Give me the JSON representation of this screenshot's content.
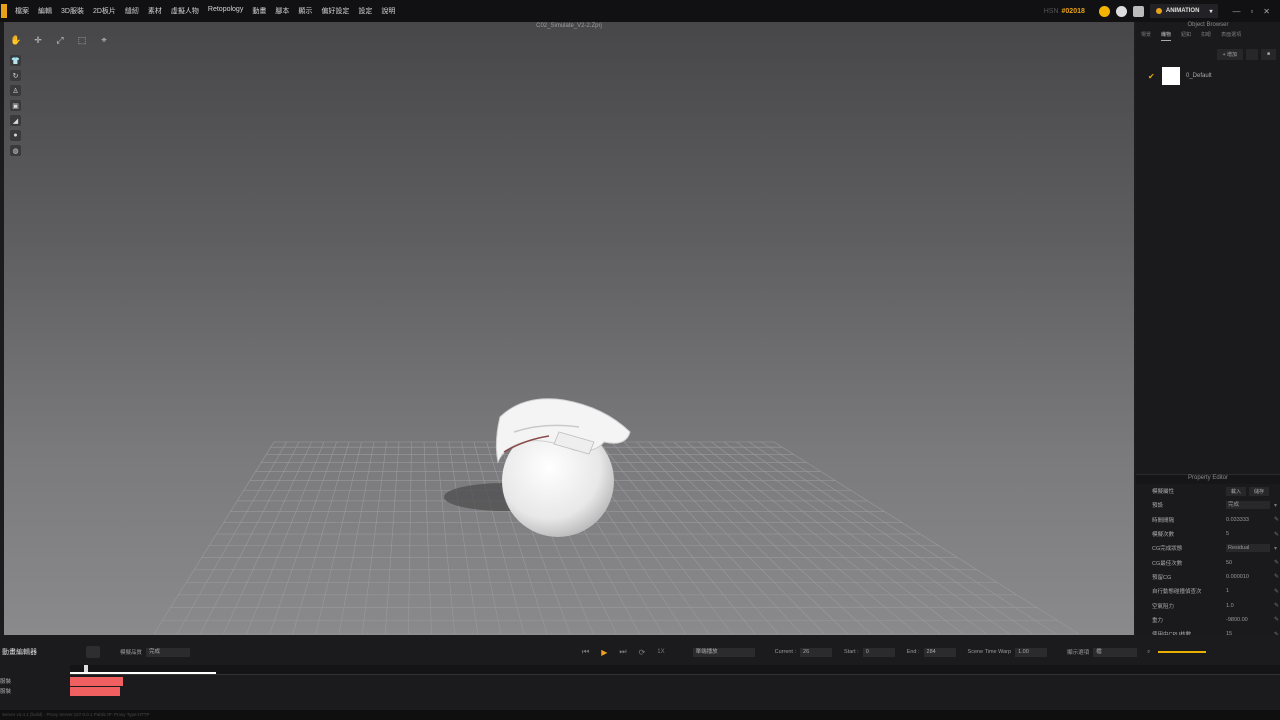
{
  "menu": [
    "檔案",
    "編輯",
    "3D服裝",
    "2D板片",
    "縫紉",
    "素材",
    "虛擬人物",
    "Retopology",
    "動畫",
    "腳本",
    "顯示",
    "偏好設定",
    "設定",
    "說明"
  ],
  "license": {
    "prefix": "HSN",
    "id": "#02018"
  },
  "mode": {
    "label": "ANIMATION"
  },
  "viewport": {
    "title": "C02_Simulate_V2-2.Zprj"
  },
  "icons": {
    "toolbar": [
      "hand-icon",
      "move-icon",
      "select-icon",
      "transform-icon",
      "pin-icon"
    ],
    "side": [
      "shirt-icon",
      "rotate-icon",
      "avatar-icon",
      "garment-icon",
      "eraser-icon",
      "head-icon",
      "globe-icon"
    ]
  },
  "object_browser": {
    "title": "Object Browser",
    "tabs": [
      "場景",
      "織物",
      "鈕釦",
      "扣眼",
      "表面選項"
    ],
    "active_tab": 1,
    "actions": [
      "+ 增加",
      "",
      "■"
    ],
    "items": [
      {
        "name": "0_Default",
        "swatch": "#ffffff",
        "checked": true
      }
    ]
  },
  "property_editor": {
    "title": "Property Editor",
    "header_label": "模擬屬性",
    "header_buttons": [
      "載入",
      "儲存"
    ],
    "rows": [
      {
        "key": "預設",
        "value": "完成",
        "kind": "select"
      },
      {
        "key": "時間間隔",
        "value": "0.033333",
        "kind": "edit"
      },
      {
        "key": "模擬次數",
        "value": "5",
        "kind": "edit"
      },
      {
        "key": "CG完成狀態",
        "value": "Residual",
        "kind": "select"
      },
      {
        "key": "CG最佳次數",
        "value": "50",
        "kind": "edit"
      },
      {
        "key": "預留CG",
        "value": "0.000010",
        "kind": "edit"
      },
      {
        "key": "自行動態碰撞偵查次",
        "value": "1",
        "kind": "edit"
      },
      {
        "key": "空氣阻力",
        "value": "1.0",
        "kind": "edit"
      },
      {
        "key": "重力",
        "value": "-9800.00",
        "kind": "edit"
      },
      {
        "key": "使用中CPU核數",
        "value": "15",
        "kind": "edit"
      }
    ]
  },
  "timeline": {
    "title": "動畫編輯器",
    "record_label": "模擬品質",
    "record_value": "完成",
    "play_mode": "單端播放",
    "current_label": "Current :",
    "current": "26",
    "start_label": "Start :",
    "start": "0",
    "end_label": "End :",
    "end": "284",
    "warp_label": "Scene Time Warp",
    "warp": "1.00",
    "view_label": "顯示選項",
    "view_value": "檔",
    "tracks": [
      {
        "name": "服裝",
        "clip_fraction": 0.044
      },
      {
        "name": "服裝",
        "clip_fraction": 0.041
      }
    ],
    "status": "Server v3.4.1 (build) · Proxy Server:127.0.0.1 Public IP:    Proxy Type:HTTP"
  },
  "colors": {
    "accent": "#e8a21a",
    "clip": "#f06060",
    "swatch": "#ffffff"
  }
}
